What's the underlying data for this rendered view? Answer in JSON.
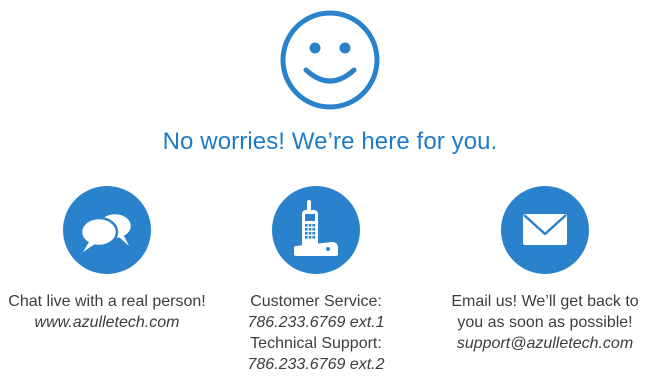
{
  "headline": "No worries! We’re here for you.",
  "colors": {
    "brand_blue": "#2a82cc",
    "headline_blue": "#1f7bc7",
    "text": "#3d3d3d"
  },
  "icons": {
    "hero": "smiley-face-icon",
    "chat": "chat-bubbles-icon",
    "phone": "cordless-phone-icon",
    "email": "envelope-icon"
  },
  "chat": {
    "line1": "Chat live with a real person!",
    "website": "www.azulletech.com"
  },
  "phone": {
    "customer_service_label": "Customer Service:",
    "customer_service_number": "786.233.6769 ext.1",
    "technical_support_label": "Technical Support:",
    "technical_support_number": "786.233.6769 ext.2"
  },
  "email": {
    "line1": "Email us! We’ll get back to",
    "line2": "you as soon as possible!",
    "address": "support@azulletech.com"
  }
}
